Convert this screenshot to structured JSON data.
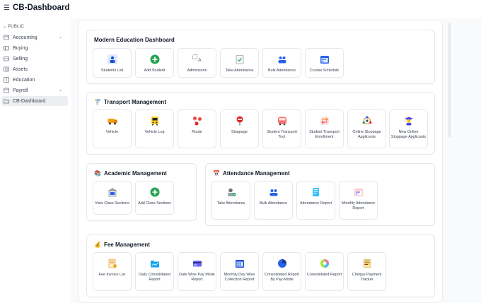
{
  "header": {
    "menu_icon": "hamburger-icon",
    "title": "CB-Dashboard"
  },
  "sidebar": {
    "section_label": "PUBLIC",
    "items": [
      {
        "label": "Accounting",
        "icon": "accounting-icon",
        "expandable": true
      },
      {
        "label": "Buying",
        "icon": "buying-icon",
        "expandable": false
      },
      {
        "label": "Selling",
        "icon": "selling-icon",
        "expandable": false
      },
      {
        "label": "Assets",
        "icon": "assets-icon",
        "expandable": false
      },
      {
        "label": "Education",
        "icon": "education-icon",
        "expandable": false
      },
      {
        "label": "Payroll",
        "icon": "payroll-icon",
        "expandable": true
      },
      {
        "label": "CB-Dashboard",
        "icon": "folder-icon",
        "expandable": false,
        "active": true
      }
    ]
  },
  "sections": {
    "modern": {
      "title": "Modern Education Dashboard",
      "tiles": [
        "Students List",
        "Add Student",
        "Admissions",
        "Take Attendance",
        "Bulk Attendance",
        "Course Schedule"
      ]
    },
    "transport": {
      "title": "Transport Management",
      "tiles": [
        "Vehicle",
        "Vehicle Log",
        "Route",
        "Stoppage",
        "Student Transport Tool",
        "Student Transport Enrollment",
        "Online Stoppage Applicants",
        "New Online Stoppage Applicants"
      ]
    },
    "academic": {
      "title": "Academic Management",
      "tiles": [
        "View Class Sections",
        "Add Class Sections"
      ]
    },
    "attendance": {
      "title": "Attendance Management",
      "tiles": [
        "Take Attendance",
        "Bulk Attendance",
        "Attendance Report",
        "Monthly Attendance Report"
      ]
    },
    "fee": {
      "title": "Fee Management",
      "tiles": [
        "Fee Invoice List",
        "Daily Consolidated Report",
        "Date Wise Pay Mode Report",
        "Monthly Day Wise Collection Report",
        "Consolidated Report By Pay-Mode",
        "Consolidated Report",
        "Cheque Payment Tracker"
      ]
    }
  },
  "broken_image_text": "A",
  "colors": {
    "accent_green": "#22a352",
    "accent_blue": "#2563eb",
    "accent_red": "#dc2626"
  }
}
